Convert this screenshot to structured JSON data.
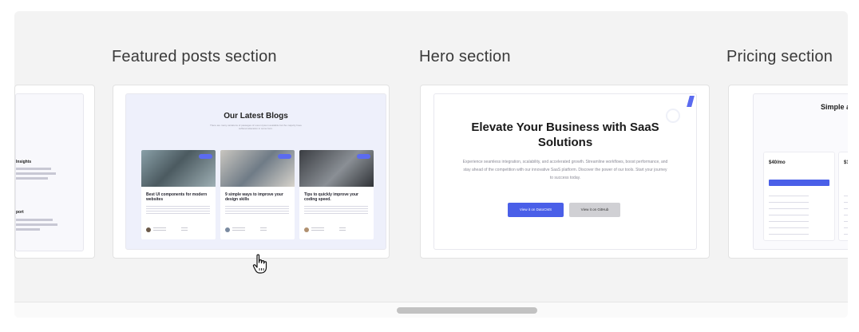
{
  "sections": [
    {
      "label": "Featured posts section"
    },
    {
      "label": "Hero section"
    },
    {
      "label": "Pricing section"
    }
  ],
  "left_card": {
    "line1": "Insights",
    "line2": "port"
  },
  "blog_preview": {
    "title": "Our Latest Blogs",
    "subtitle": "There are many variations of passages of Lorem Ipsum available but the majority have suffered alteration in some form.",
    "posts": [
      {
        "title": "Best UI components for modern websites"
      },
      {
        "title": "9 simple ways to improve your design skills"
      },
      {
        "title": "Tips to quickly improve your coding speed."
      }
    ]
  },
  "hero_preview": {
    "title": "Elevate Your Business with SaaS Solutions",
    "text": "Experience seamless integration, scalability, and accelerated growth. Streamline workflows, boost performance, and stay ahead of the competition with our innovative SaaS platform. Discover the power of our tools. Start your journey to success today.",
    "primary_button": "View it on DatoCMS",
    "secondary_button": "View it on GitHub"
  },
  "pricing_preview": {
    "title": "Simple a",
    "price": "$40/mo",
    "price_cut": "$1"
  },
  "colors": {
    "accent": "#4a5fe8",
    "carousel_bg": "#f3f3f3",
    "scroll_thumb": "#c2c2c2"
  }
}
